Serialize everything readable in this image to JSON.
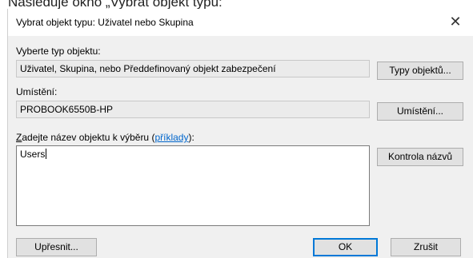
{
  "caption": "Následuje okno „Vybrat objekt typu:",
  "dialog": {
    "title": "Vybrat objekt typu: Uživatel nebo Skupina",
    "close_glyph": "✕"
  },
  "object_type": {
    "label": "Vyberte typ objektu:",
    "value": "Uživatel, Skupina, nebo Předdefinovaný objekt zabezpečení",
    "button": "Typy objektů..."
  },
  "location": {
    "label": "Umístění:",
    "value": "PROBOOK6550B-HP",
    "button": "Umístění..."
  },
  "object_name": {
    "label_prefix": "Z",
    "label_rest": "adejte název objektu k výběru (",
    "label_link": "příklady",
    "label_suffix": "):",
    "value": "Users",
    "check_button": "Kontrola názvů"
  },
  "footer": {
    "advanced_button": "Upřesnit...",
    "ok_button": "OK",
    "cancel_button": "Zrušit"
  },
  "colors": {
    "client_background": "#f0f0f0",
    "link": "#0066cc",
    "default_button_border": "#0078d7"
  }
}
